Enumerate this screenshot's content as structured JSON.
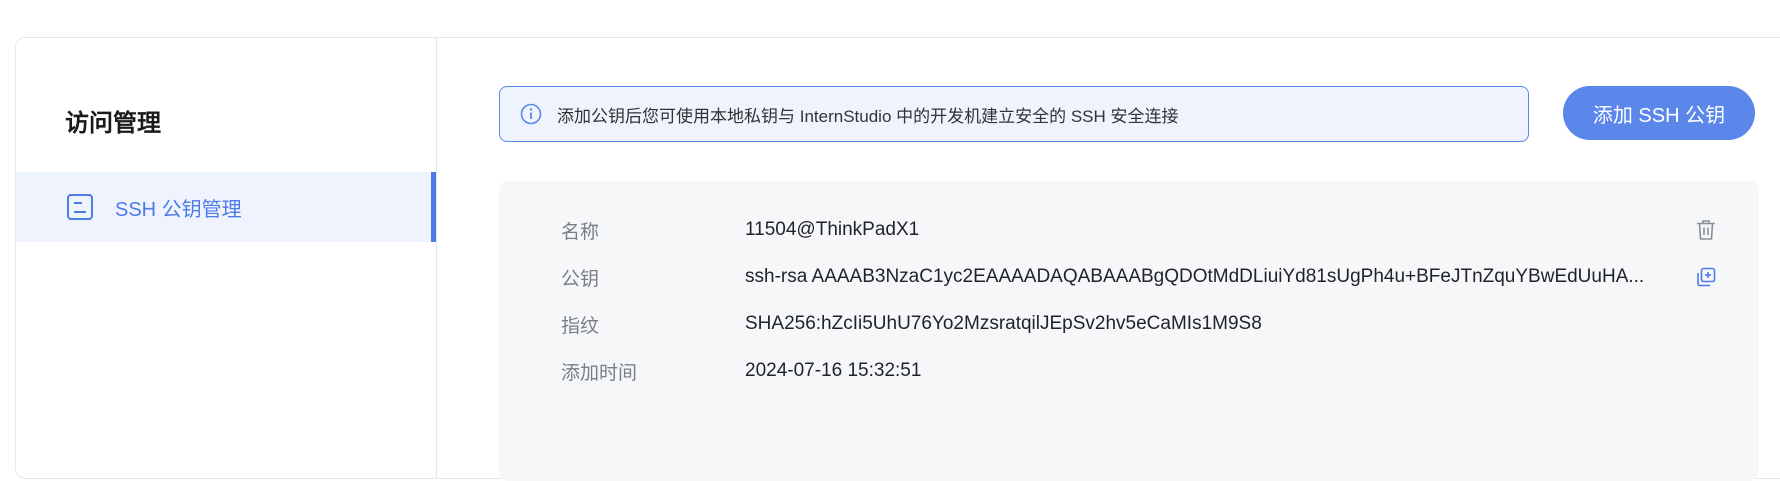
{
  "sidebar": {
    "title": "访问管理",
    "items": [
      {
        "label": "SSH 公钥管理",
        "icon": "document-list-icon",
        "active": true
      }
    ]
  },
  "alert": {
    "icon": "info-circle-icon",
    "text": "添加公钥后您可使用本地私钥与 InternStudio 中的开发机建立安全的 SSH 安全连接"
  },
  "add_button": {
    "label": "添加 SSH 公钥"
  },
  "keys": [
    {
      "name_label": "名称",
      "name": "11504@ThinkPadX1",
      "key_label": "公钥",
      "key": "ssh-rsa AAAAB3NzaC1yc2EAAAADAQABAAABgQDOtMdDLiuiYd81sUgPh4u+BFeJTnZquYBwEdUuHA...",
      "fingerprint_label": "指纹",
      "fingerprint": "SHA256:hZcIi5UhU76Yo2MzsratqilJEpSv2hv5eCaMIs1M9S8",
      "time_label": "添加时间",
      "time": "2024-07-16 15:32:51"
    }
  ],
  "colors": {
    "accent": "#4d7be8",
    "button": "#5b87ea",
    "alert_bg": "#eef3fd",
    "panel_bg": "#f6f7f9"
  }
}
